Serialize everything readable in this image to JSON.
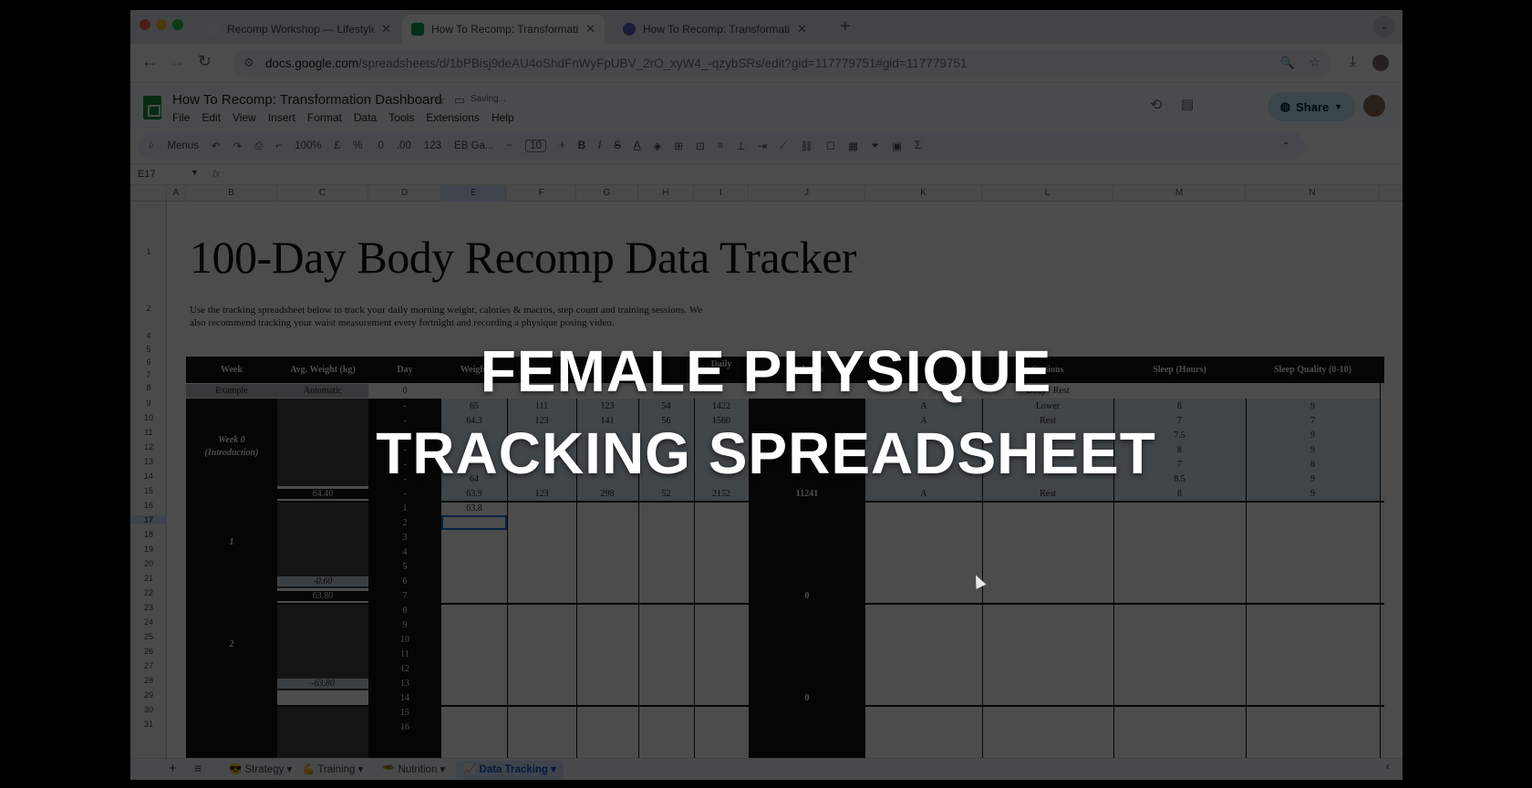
{
  "browser": {
    "tabs": [
      {
        "label": "Recomp Workshop — Lifestyle",
        "color": "#e8eaed",
        "active": false
      },
      {
        "label": "How To Recomp: Transformation",
        "color": "#0f9d58",
        "active": true
      },
      {
        "label": "How To Recomp: Transformation",
        "color": "#5b5fc7",
        "active": false
      }
    ],
    "url_host": "docs.google.com",
    "url_path": "/spreadsheets/d/1bPBisj9deAU4oShdFnWyFpUBV_2rO_xyW4_-qzybSRs/edit?gid=117779751#gid=117779751"
  },
  "sheets": {
    "title": "How To Recomp: Transformation Dashboard",
    "saving": "Saving...",
    "menu": [
      "File",
      "Edit",
      "View",
      "Insert",
      "Format",
      "Data",
      "Tools",
      "Extensions",
      "Help"
    ],
    "share_label": "Share",
    "toolbar": {
      "menus": "Menus",
      "zoom": "100%",
      "currency": "£",
      "percent": "%",
      "dec_less": ".0",
      "dec_more": ".00",
      "num_format": "123",
      "font": "EB Ga...",
      "font_size": "10"
    },
    "cell_ref": "E17",
    "fx": "fx",
    "columns": [
      "A",
      "B",
      "C",
      "D",
      "E",
      "F",
      "G",
      "H",
      "I",
      "J",
      "K",
      "L",
      "M",
      "N"
    ],
    "rows": [
      "1",
      "2",
      "4",
      "5",
      "6",
      "7",
      "8",
      "9",
      "10",
      "11",
      "12",
      "13",
      "14",
      "15",
      "16",
      "17",
      "18",
      "19",
      "20",
      "21",
      "22",
      "23",
      "24",
      "25",
      "26",
      "27",
      "28",
      "29",
      "30",
      "31"
    ]
  },
  "doc": {
    "title": "100-Day Body Recomp Data Tracker",
    "intro": "Use the tracking spreadsheet below to track your daily morning weight, calories & macros, step count and training sessions. We also recommend tracking your waist measurement every fortnight and recording a physique posing video."
  },
  "table": {
    "headers": {
      "week": "Week",
      "avg_weight": "Avg. Weight (kg)",
      "day": "Day",
      "weight": "Weight",
      "daily": "Daily",
      "calories": "Calories",
      "sessions": "Sessions",
      "sleep_hours": "Sleep (Hours)",
      "sleep_quality": "Sleep Quality (0-10)"
    },
    "example": {
      "week": "Example",
      "avg": "Automatic",
      "day": "0",
      "sessions": "Body / Rest"
    },
    "week0_label": "Week 0",
    "week0_sub": "(Introduction)",
    "week0_rows": [
      {
        "day": "-",
        "weight": "65",
        "f": "111",
        "g": "123",
        "h": "54",
        "i": "1422",
        "k": "A",
        "l": "Lower",
        "m": "8",
        "n": "9"
      },
      {
        "day": "-",
        "weight": "64.3",
        "f": "123",
        "g": "141",
        "h": "56",
        "i": "1560",
        "k": "A",
        "l": "Rest",
        "m": "7",
        "n": "7"
      },
      {
        "day": "-",
        "weight": "",
        "f": "",
        "g": "",
        "h": "",
        "i": "",
        "k": "",
        "l": "",
        "m": "7.5",
        "n": "9"
      },
      {
        "day": "-",
        "weight": "",
        "f": "",
        "g": "",
        "h": "",
        "i": "",
        "k": "",
        "l": "",
        "m": "8",
        "n": "9"
      },
      {
        "day": "-",
        "weight": "",
        "f": "",
        "g": "",
        "h": "",
        "i": "",
        "k": "",
        "l": "",
        "m": "7",
        "n": "8"
      },
      {
        "day": "-",
        "weight": "64",
        "f": "",
        "g": "",
        "h": "",
        "i": "",
        "k": "",
        "l": "",
        "m": "8.5",
        "n": "9"
      },
      {
        "day": "-",
        "weight": "63.9",
        "f": "123",
        "g": "298",
        "h": "52",
        "i": "2152",
        "k": "A",
        "l": "Rest",
        "m": "8",
        "n": "9"
      }
    ],
    "week0_avg": "64.40",
    "week0_steps": "11241",
    "week1_label": "1",
    "week1_days": [
      "1",
      "2",
      "3",
      "4",
      "5",
      "6",
      "7"
    ],
    "week1_first_weight": "63.8",
    "week1_change": "-0.60",
    "week1_avg": "63.80",
    "week1_steps": "0",
    "week2_label": "2",
    "week2_days": [
      "8",
      "9",
      "10",
      "11",
      "12",
      "13",
      "14"
    ],
    "week2_change": "-63.80",
    "week2_steps": "0",
    "week3_days": [
      "15",
      "16"
    ]
  },
  "sheet_tabs": [
    {
      "label": "😎 Strategy ▾",
      "active": false
    },
    {
      "label": "💪 Training ▾",
      "active": false
    },
    {
      "label": "🥗 Nutrition ▾",
      "active": false
    },
    {
      "label": "📈 Data Tracking ▾",
      "active": true
    }
  ],
  "overlay": {
    "line1": "FEMALE PHYSIQUE",
    "line2": "TRACKING SPREADSHEET"
  }
}
